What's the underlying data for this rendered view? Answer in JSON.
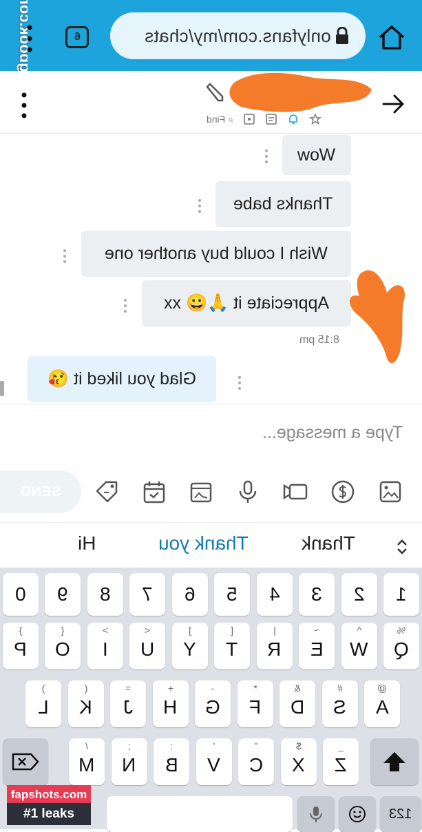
{
  "browser": {
    "url": "onlyfans.com/my/chats",
    "tab_count": "6",
    "side_watermark": "fapeningbook.com"
  },
  "header": {
    "find_label": "Find"
  },
  "messages": [
    {
      "text": "Wow",
      "sender": "other"
    },
    {
      "text": "Thanks babe",
      "sender": "other"
    },
    {
      "text": "Wish I could buy another one",
      "sender": "other"
    },
    {
      "text": "Appreciate it 🙏😀 xx",
      "sender": "other"
    },
    {
      "text": "Glad you liked it 😘",
      "sender": "me"
    }
  ],
  "timestamp": "8:15 pm",
  "composer": {
    "placeholder": "Type a message...",
    "send_label": "SEND",
    "tools": [
      "image-icon",
      "dollar-icon",
      "video-icon",
      "microphone-icon",
      "vault-icon",
      "schedule-icon",
      "price-tag-icon"
    ]
  },
  "suggestions": {
    "items": [
      "Thank",
      "Thank you",
      "Hi"
    ]
  },
  "keyboard": {
    "number_row": [
      "1",
      "2",
      "3",
      "4",
      "5",
      "6",
      "7",
      "8",
      "9",
      "0"
    ],
    "row1": [
      {
        "main": "Q",
        "sub": "%"
      },
      {
        "main": "W",
        "sub": "^"
      },
      {
        "main": "E",
        "sub": "~"
      },
      {
        "main": "R",
        "sub": "|"
      },
      {
        "main": "T",
        "sub": "["
      },
      {
        "main": "Y",
        "sub": "]"
      },
      {
        "main": "U",
        "sub": "<"
      },
      {
        "main": "I",
        "sub": ">"
      },
      {
        "main": "O",
        "sub": "{"
      },
      {
        "main": "P",
        "sub": "}"
      }
    ],
    "row2": [
      {
        "main": "A",
        "sub": "@"
      },
      {
        "main": "S",
        "sub": "#"
      },
      {
        "main": "D",
        "sub": "&"
      },
      {
        "main": "F",
        "sub": "*"
      },
      {
        "main": "G",
        "sub": "-"
      },
      {
        "main": "H",
        "sub": "+"
      },
      {
        "main": "J",
        "sub": "="
      },
      {
        "main": "K",
        "sub": "("
      },
      {
        "main": "L",
        "sub": ")"
      }
    ],
    "row3": [
      {
        "main": "Z",
        "sub": "_"
      },
      {
        "main": "X",
        "sub": "$"
      },
      {
        "main": "C",
        "sub": "\""
      },
      {
        "main": "V",
        "sub": "'"
      },
      {
        "main": "B",
        "sub": ":"
      },
      {
        "main": "N",
        "sub": ";"
      },
      {
        "main": "M",
        "sub": "/"
      }
    ],
    "mode_label": "123"
  },
  "watermark": {
    "line1": "fapshots.com",
    "line2": "#1 leaks"
  },
  "colors": {
    "browser_bar": "#1ea4dd",
    "accent_suggestion": "#157bb1",
    "redaction": "#f47b2a"
  }
}
